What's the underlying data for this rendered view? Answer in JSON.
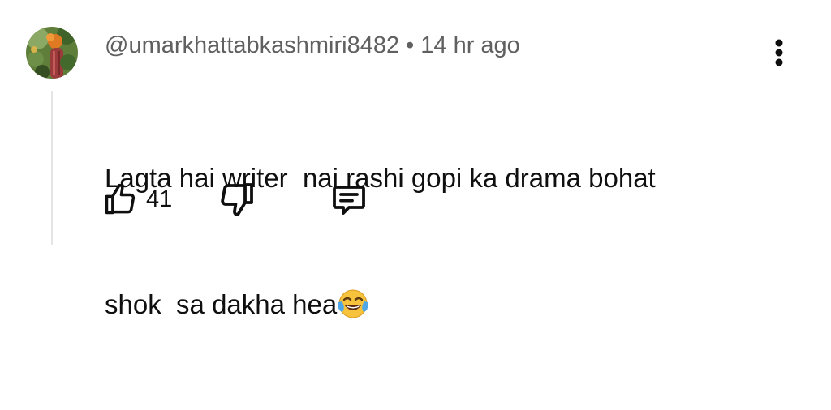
{
  "comment": {
    "author": "@umarkhattabkashmiri8482",
    "separator": "•",
    "timestamp": "14 hr ago",
    "text_line1": "Lagta hai writer  nai rashi gopi ka drama bohat",
    "text_line2": "shok  sa dakha hea",
    "emoji": "face-with-tears-of-joy",
    "likes": "41"
  },
  "icons": {
    "more": "more-vertical-icon",
    "like": "thumbs-up-icon",
    "dislike": "thumbs-down-icon",
    "reply": "reply-comment-icon"
  },
  "colors": {
    "text_primary": "#0f0f0f",
    "text_secondary": "#606060",
    "thread_line": "#e5e5e5",
    "emoji_face": "#f7c23c"
  }
}
